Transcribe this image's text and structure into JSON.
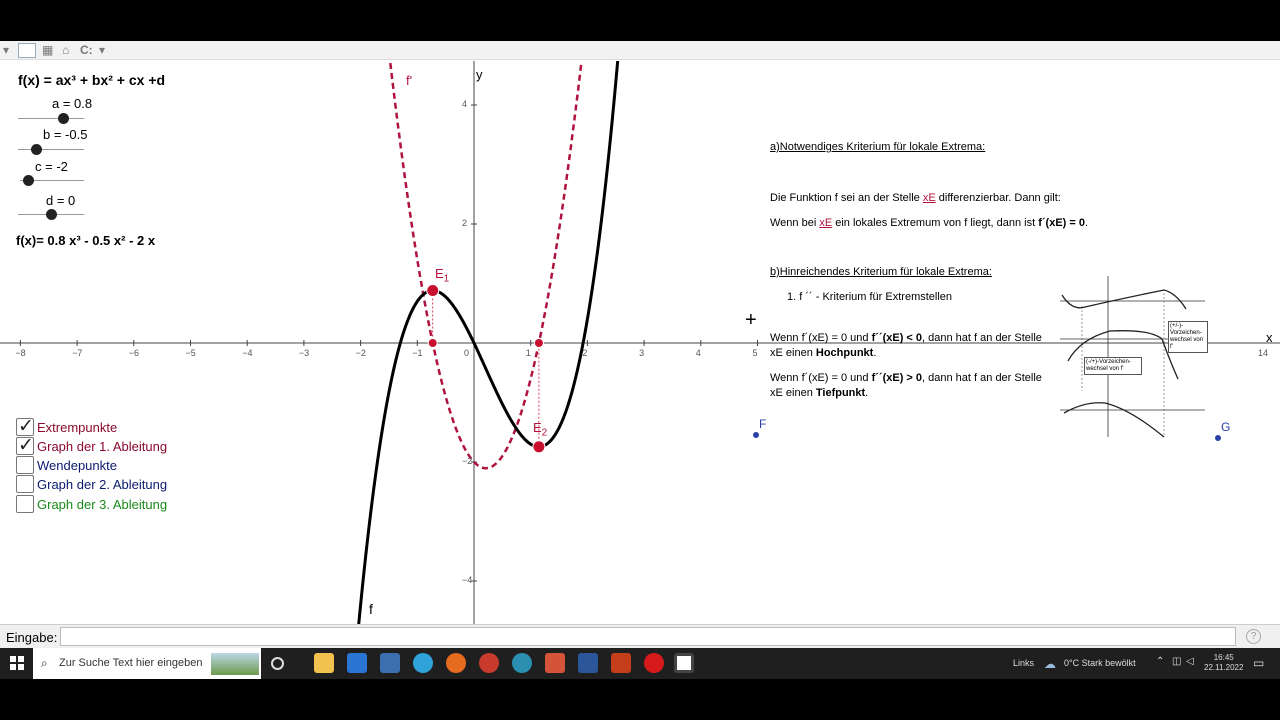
{
  "toolbar": {
    "drive_label": "C:"
  },
  "algebra": {
    "formula_general": "f(x) = ax³ + bx² + cx +d",
    "sliders": [
      {
        "name": "a",
        "label": "a = 0.8",
        "value": 0.8
      },
      {
        "name": "b",
        "label": "b = -0.5",
        "value": -0.5
      },
      {
        "name": "c",
        "label": "c = -2",
        "value": -2
      },
      {
        "name": "d",
        "label": "d = 0",
        "value": 0
      }
    ],
    "formula_specific": "f(x)= 0.8 x³ - 0.5 x² - 2 x"
  },
  "checkboxes": [
    {
      "label": "Extrempunkte",
      "checked": true,
      "color": "#8b0a2e"
    },
    {
      "label": "Graph der 1. Ableitung",
      "checked": true,
      "color": "#8b0a2e"
    },
    {
      "label": "Wendepunkte",
      "checked": false,
      "color": "#0c1a6e"
    },
    {
      "label": "Graph der 2. Ableitung",
      "checked": false,
      "color": "#0c1a6e"
    },
    {
      "label": "Graph der 3. Ableitung",
      "checked": false,
      "color": "#1a8a1a"
    }
  ],
  "graph": {
    "x_axis_label": "x",
    "y_axis_label": "y",
    "x_ticks": [
      "−8",
      "−7",
      "−6",
      "−5",
      "−4",
      "−3",
      "−2",
      "−1",
      "0",
      "1",
      "2",
      "3",
      "4",
      "5",
      "14"
    ],
    "y_ticks": [
      "4",
      "2",
      "−2",
      "−4"
    ],
    "f_label": "f",
    "fprime_label": "f'",
    "e1_label": "E",
    "e1_sub": "1",
    "e2_label": "E",
    "e2_sub": "2",
    "point_f": "F",
    "point_g": "G",
    "curve_color": "#000000",
    "derivative_color": "#b0133d",
    "extrema_color": "#c8102e"
  },
  "document": {
    "heading_a": "a)Notwendiges Kriterium für lokale Extrema:",
    "line_a1_pre": "Die Funktion f sei an der Stelle ",
    "line_a1_var": "xE",
    "line_a1_post": " differenzierbar. Dann gilt:",
    "line_a2_pre": "Wenn bei ",
    "line_a2_var": "xE",
    "line_a2_mid": " ein lokales Extremum von f liegt, dann ist ",
    "line_a2_bold": "f´(xE) = 0",
    "line_a2_end": ".",
    "heading_b": "b)Hinreichendes Kriterium für lokale Extrema:",
    "item_1": "1.   f ´´ - Kriterium für Extremstellen",
    "rule1_line1_pre": "Wenn f´(xE) = 0 und ",
    "rule1_line1_bold": "f´´(xE) < 0",
    "rule1_line1_post": ", dann hat f an der Stelle",
    "rule1_line2_pre": "xE einen ",
    "rule1_line2_bold": "Hochpunkt",
    "rule1_line2_post": ".",
    "rule2_line1_pre": "Wenn f´(xE) = 0 und ",
    "rule2_line1_bold": "f´´(xE) > 0",
    "rule2_line1_post": ", dann hat f an der Stelle",
    "rule2_line2_pre": "xE einen ",
    "rule2_line2_bold": "Tiefpunkt",
    "rule2_line2_post": ".",
    "figure_note_1": "(+/-)-Vorzeichen-wechsel von f'",
    "figure_note_2": "(-/+)-Vorzeichen-wechsel von f'"
  },
  "input_bar": {
    "label": "Eingabe:",
    "value": "",
    "help": "?"
  },
  "taskbar": {
    "search_placeholder": "Zur Suche Text hier eingeben",
    "links": "Links",
    "weather": "0°C  Stark bewölkt",
    "time": "16:45",
    "date": "22.11.2022"
  }
}
